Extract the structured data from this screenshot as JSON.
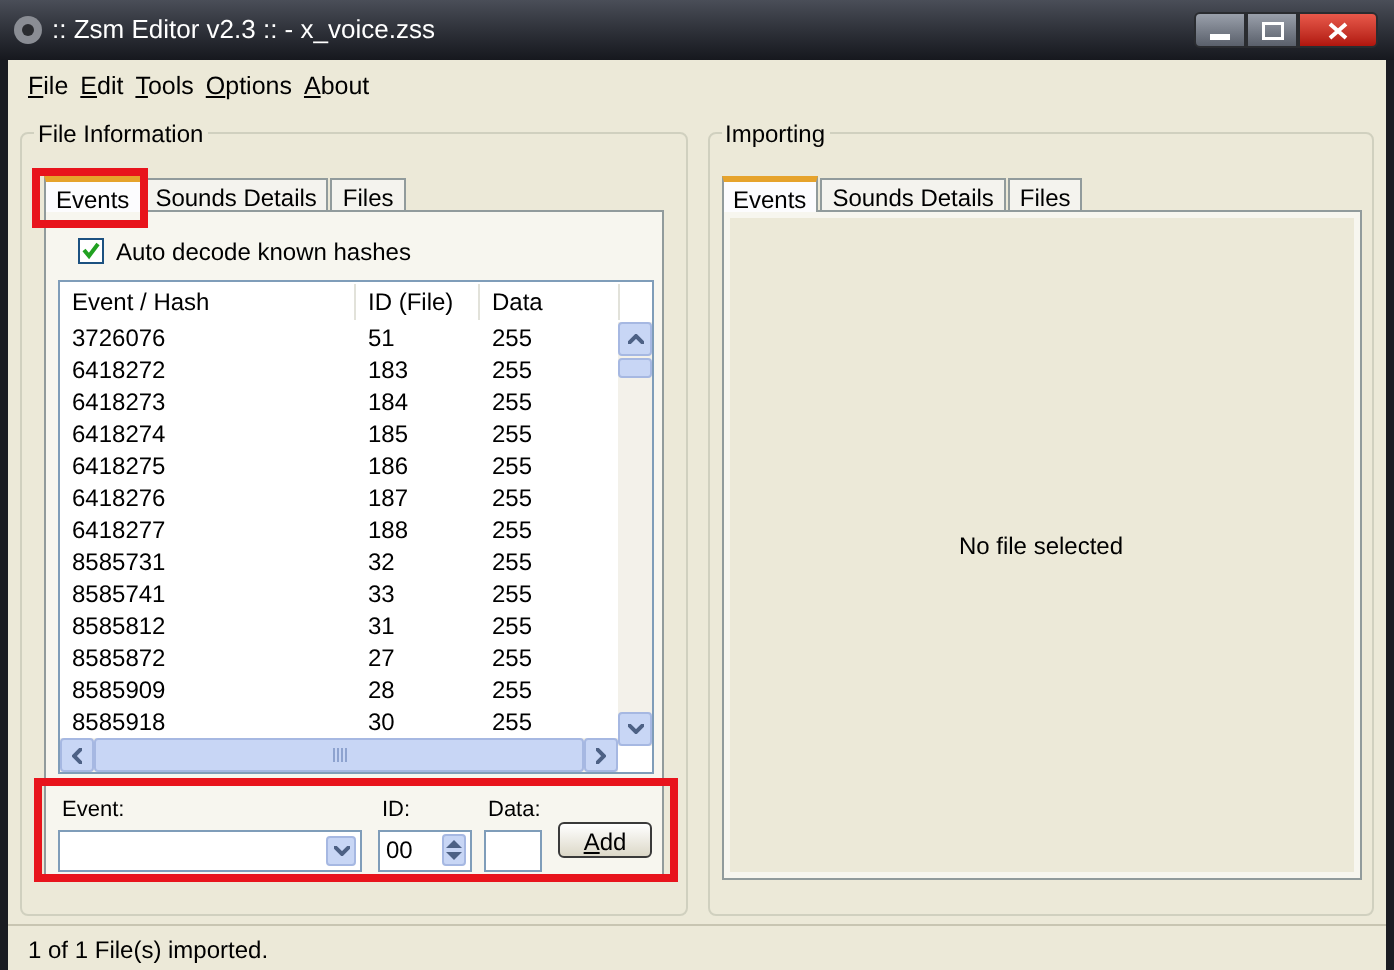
{
  "window": {
    "title": ":: Zsm Editor v2.3 :: - x_voice.zss"
  },
  "menu": [
    "File",
    "Edit",
    "Tools",
    "Options",
    "About"
  ],
  "file_information": {
    "title": "File Information",
    "tabs": [
      {
        "label": "Events",
        "selected": true,
        "highlight": true
      },
      {
        "label": "Sounds Details",
        "selected": false
      },
      {
        "label": "Files",
        "selected": false
      }
    ],
    "auto_decode": {
      "label": "Auto decode known hashes",
      "checked": true
    },
    "table": {
      "columns": [
        "Event / Hash",
        "ID (File)",
        "Data"
      ],
      "rows": [
        [
          "3726076",
          "51",
          "255"
        ],
        [
          "6418272",
          "183",
          "255"
        ],
        [
          "6418273",
          "184",
          "255"
        ],
        [
          "6418274",
          "185",
          "255"
        ],
        [
          "6418275",
          "186",
          "255"
        ],
        [
          "6418276",
          "187",
          "255"
        ],
        [
          "6418277",
          "188",
          "255"
        ],
        [
          "8585731",
          "32",
          "255"
        ],
        [
          "8585741",
          "33",
          "255"
        ],
        [
          "8585812",
          "31",
          "255"
        ],
        [
          "8585872",
          "27",
          "255"
        ],
        [
          "8585909",
          "28",
          "255"
        ],
        [
          "8585918",
          "30",
          "255"
        ]
      ]
    },
    "add_form": {
      "highlight": true,
      "event_label": "Event:",
      "id_label": "ID:",
      "id_value": "00",
      "data_label": "Data:",
      "add_button": "Add"
    }
  },
  "importing": {
    "title": "Importing",
    "tabs": [
      {
        "label": "Events",
        "selected": true
      },
      {
        "label": "Sounds Details",
        "selected": false
      },
      {
        "label": "Files",
        "selected": false
      }
    ],
    "message": "No file selected"
  },
  "status_bar": "1 of 1 File(s) imported."
}
